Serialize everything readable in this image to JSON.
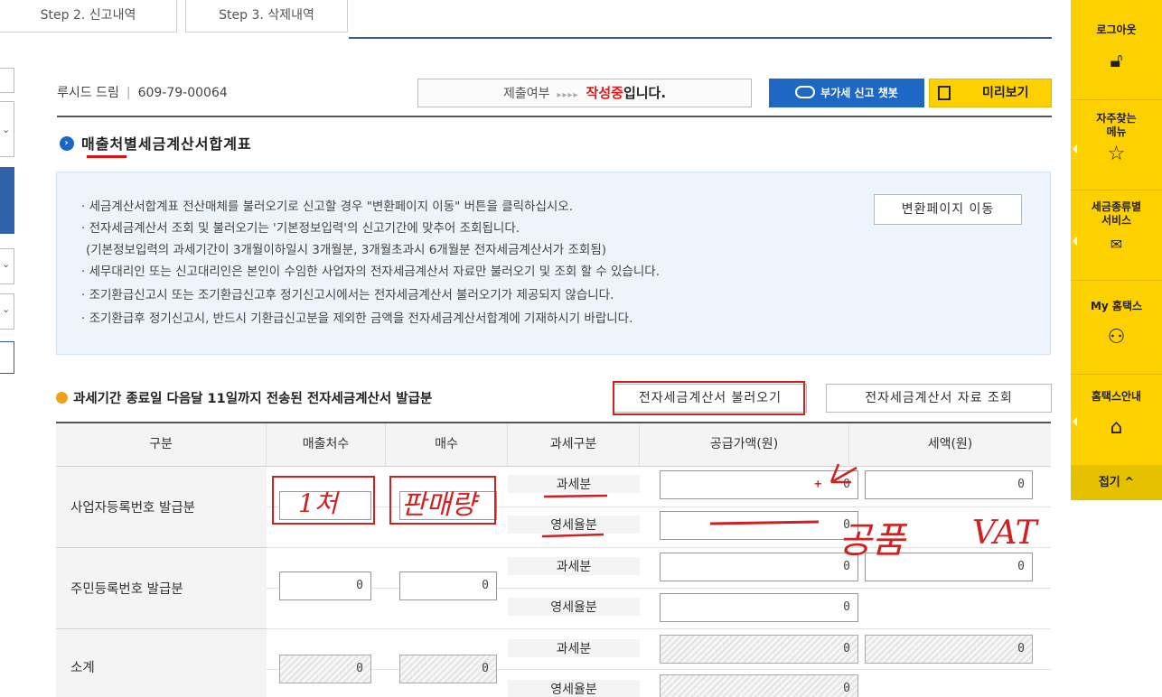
{
  "tabs": {
    "step2": "Step 2. 신고내역",
    "step3": "Step 3. 삭제내역"
  },
  "header": {
    "company_name": "루시드 드림",
    "biz_number": "609-79-00064",
    "submit_label": "제출여부",
    "submit_arrows": "▸▸▸▸",
    "submit_status": "작성중",
    "submit_suffix": "입니다.",
    "chatbot_label": "부가세 신고 챗봇",
    "preview_label": "미리보기"
  },
  "section": {
    "title": "매출처별세금계산서합계표",
    "notices": [
      "· 세금계산서합계표 전산매체를 불러오기로 신고할 경우 \"변환페이지 이동\" 버튼을 클릭하십시오.",
      "· 전자세금계산서 조회 및 불러오기는 '기본정보입력'의 신고기간에 맞추어 조회됩니다.",
      "(기본정보입력의 과세기간이 3개월이하일시 3개월분, 3개월초과시 6개월분 전자세금계산서가 조회됨)",
      "· 세무대리인 또는 신고대리인은 본인이 수임한 사업자의 전자세금계산서 자료만 불러오기 및 조회 할 수 있습니다.",
      "· 조기환급신고시 또는 조기환급신고후 정기신고시에서는 전자세금계산서 불러오기가 제공되지 않습니다.",
      "· 조기환급후 정기신고시, 반드시 기환급신고분을 제외한 금액을 전자세금계산서합계에 기재하시기 바랍니다."
    ],
    "convert_button": "변환페이지 이동"
  },
  "subsection": {
    "title": "과세기간 종료일 다음달 11일까지 전송된 전자세금계산서 발급분",
    "load_button": "전자세금계산서 불러오기",
    "lookup_button": "전자세금계산서 자료 조회"
  },
  "table": {
    "headers": [
      "구분",
      "매출처수",
      "매수",
      "과세구분",
      "공급가액(원)",
      "세액(원)"
    ],
    "rows": [
      {
        "label": "사업자등록번호 발급분",
        "count": "",
        "sheets": "",
        "taxable": "과세분",
        "zero": "영세율분",
        "supply_taxable": "0",
        "supply_zero": "0",
        "tax_taxable": "0"
      },
      {
        "label": "주민등록번호 발급분",
        "count": "0",
        "sheets": "0",
        "taxable": "과세분",
        "zero": "영세율분",
        "supply_taxable": "0",
        "supply_zero": "0",
        "tax_taxable": "0"
      },
      {
        "label": "소계",
        "count": "0",
        "sheets": "0",
        "taxable": "과세분",
        "zero": "영세율분",
        "supply_taxable": "0",
        "supply_zero": "0",
        "tax_taxable": "0"
      }
    ],
    "red_marker": "+"
  },
  "annotations": {
    "count_note": "1처",
    "sheets_note": "판매량",
    "supply_note": "공품",
    "vat_note": "VAT"
  },
  "right_sidebar": {
    "logout": "로그아웃",
    "faq_line1": "자주찾는",
    "faq_line2": "메뉴",
    "tax_line1": "세금종류별",
    "tax_line2": "서비스",
    "my": "My 홈택스",
    "guide": "홈택스안내",
    "fold": "접기 ^",
    "icons": [
      "unlock-icon",
      "star-icon",
      "mail-icon",
      "user-icon",
      "home-icon"
    ]
  },
  "colors": {
    "accent_blue": "#1f67c4",
    "sidebar_yellow": "#fdd100",
    "status_red": "#e01b1b",
    "annotation_red": "#d02020"
  }
}
